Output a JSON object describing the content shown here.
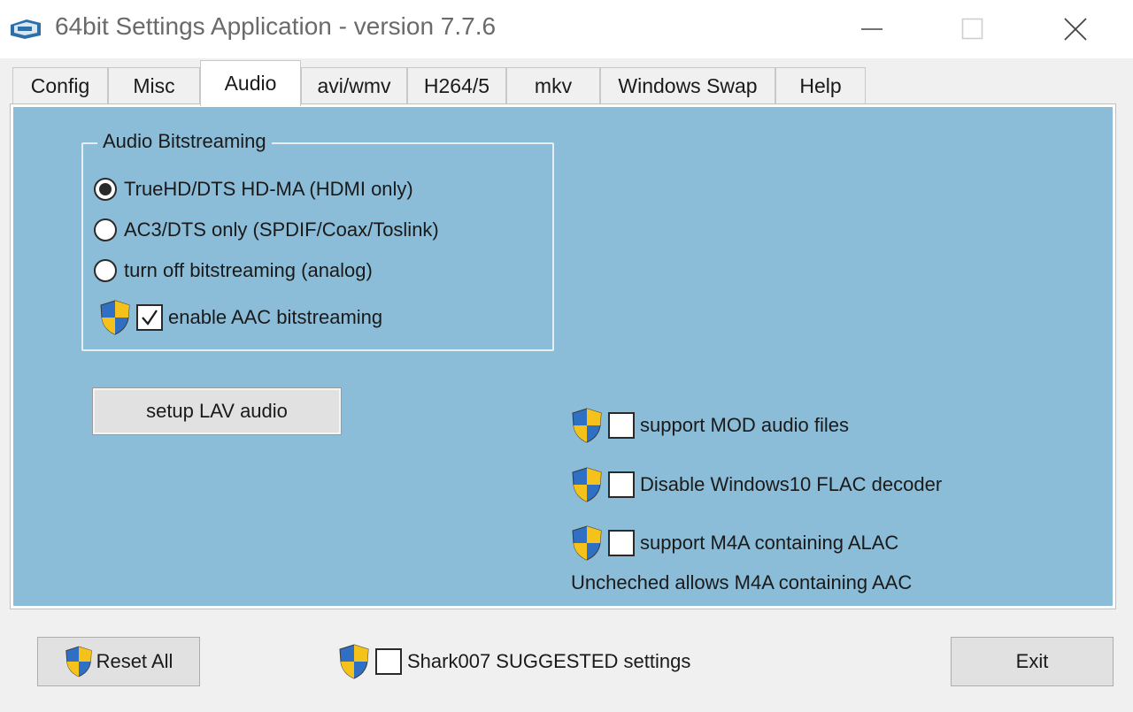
{
  "window": {
    "title": "64bit Settings Application - version 7.7.6",
    "icons": {
      "app": "app-icon",
      "minimize": "minimize-icon",
      "maximize": "maximize-icon",
      "close": "close-icon"
    }
  },
  "tabs": [
    {
      "label": "Config",
      "active": false
    },
    {
      "label": "Misc",
      "active": false
    },
    {
      "label": "Audio",
      "active": true
    },
    {
      "label": "avi/wmv",
      "active": false
    },
    {
      "label": "H264/5",
      "active": false
    },
    {
      "label": "mkv",
      "active": false
    },
    {
      "label": "Windows Swap",
      "active": false
    },
    {
      "label": "Help",
      "active": false
    }
  ],
  "audio": {
    "group_title": "Audio Bitstreaming",
    "radios": [
      {
        "label": "TrueHD/DTS HD-MA (HDMI only)",
        "checked": true
      },
      {
        "label": "AC3/DTS only (SPDIF/Coax/Toslink)",
        "checked": false
      },
      {
        "label": "turn off bitstreaming (analog)",
        "checked": false
      }
    ],
    "enable_aac": {
      "label": "enable AAC bitstreaming",
      "checked": true
    },
    "lav_button": "setup LAV audio",
    "options": [
      {
        "label": "support MOD audio files",
        "checked": false
      },
      {
        "label": "Disable Windows10 FLAC decoder",
        "checked": false
      },
      {
        "label": "support M4A containing ALAC",
        "checked": false
      }
    ],
    "note": "Uncheched allows M4A containing AAC"
  },
  "footer": {
    "reset_label": "Reset All",
    "suggested": {
      "label": "Shark007 SUGGESTED settings",
      "checked": false
    },
    "exit_label": "Exit"
  },
  "colors": {
    "panel_bg": "#8bbdd8",
    "shield_blue": "#2f6fc4",
    "shield_yellow": "#f4c21b"
  }
}
